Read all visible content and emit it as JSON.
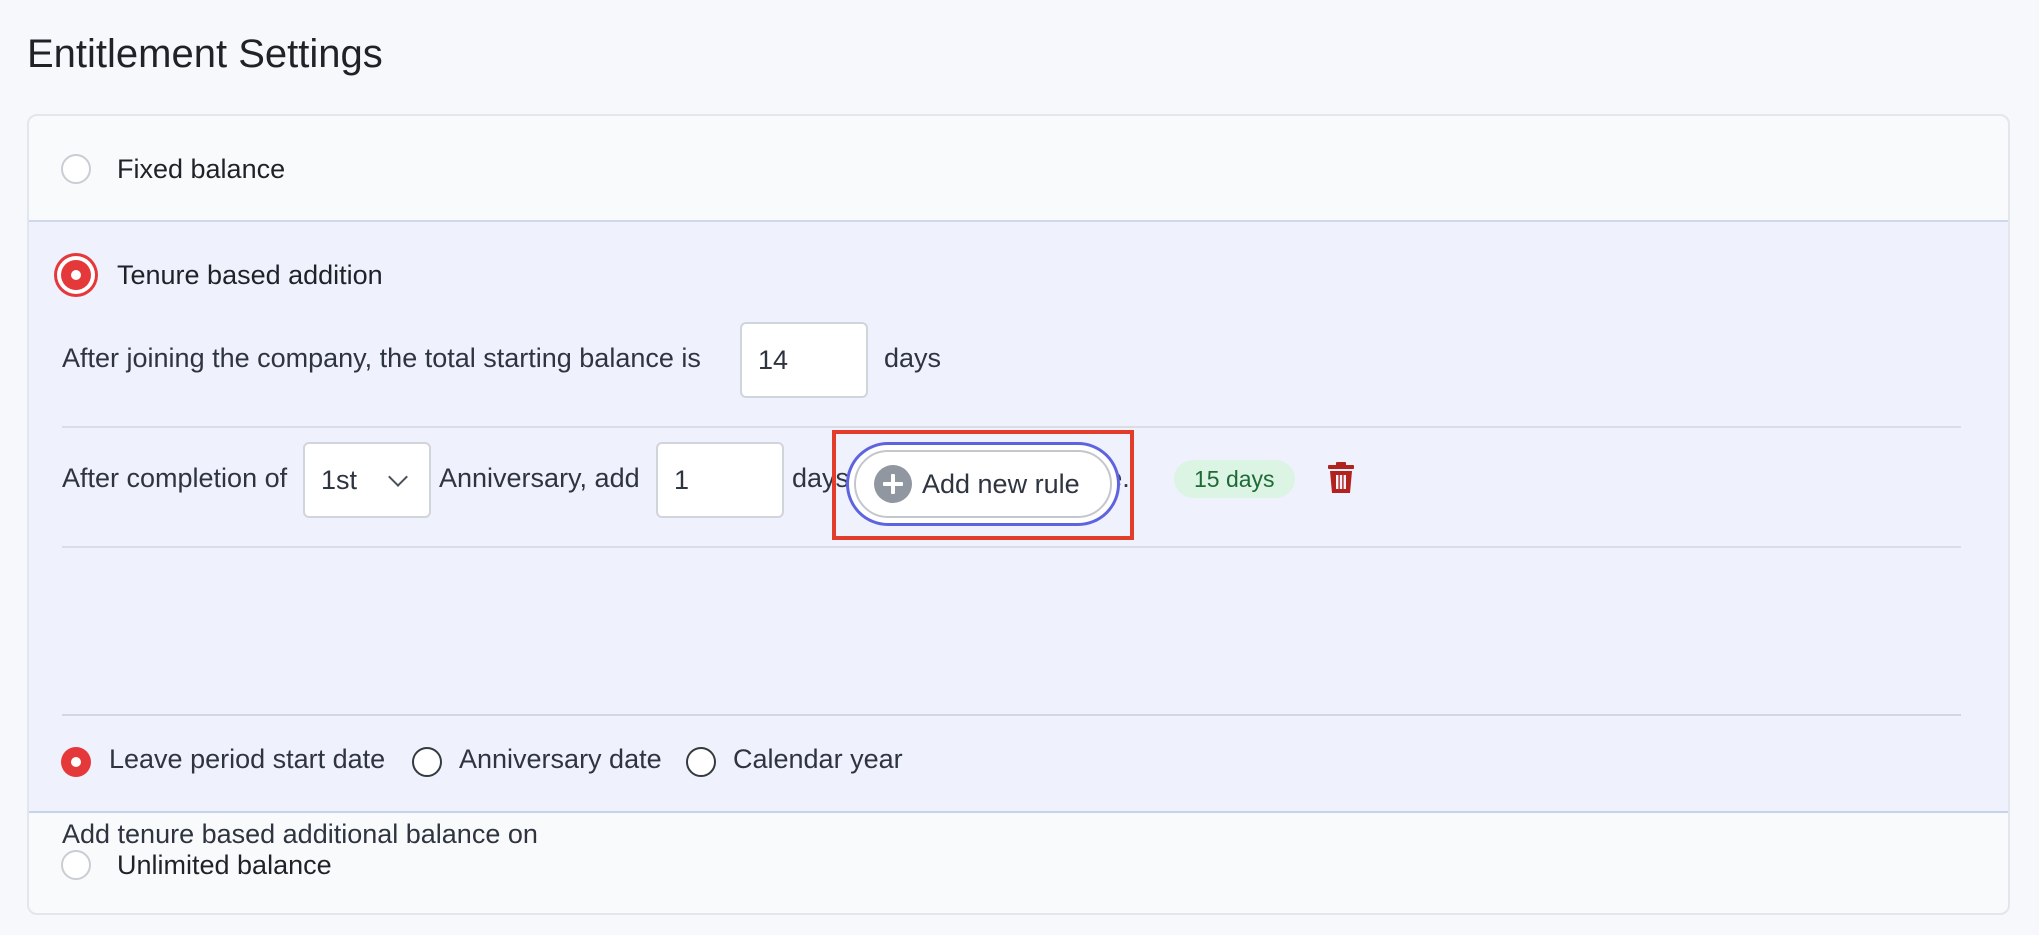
{
  "page": {
    "title": "Entitlement Settings"
  },
  "options": {
    "fixed": {
      "label": "Fixed balance",
      "selected": false
    },
    "tenure": {
      "label": "Tenure based addition",
      "selected": true
    },
    "unlimited": {
      "label": "Unlimited balance",
      "selected": false
    }
  },
  "tenure": {
    "starting_prefix": "After joining the company, the total starting balance is",
    "starting_value": "14",
    "starting_suffix": "days",
    "rules": [
      {
        "prefix": "After completion of",
        "anniversary": "1st",
        "middle": "Anniversary, add",
        "add_value": "1",
        "suffix": "days to the starting balance.",
        "total_badge": "15 days"
      }
    ],
    "add_rule_label": "Add new rule",
    "apply_on": {
      "heading": "Add tenure based additional balance on",
      "choices": [
        {
          "label": "Leave period start date",
          "selected": true
        },
        {
          "label": "Anniversary date",
          "selected": false
        },
        {
          "label": "Calendar year",
          "selected": false
        }
      ]
    }
  },
  "colors": {
    "accent_red": "#e5383b",
    "focus_blue": "#5e63e0",
    "highlight_box": "#e23c2a",
    "badge_bg": "#dcf4e4",
    "badge_text": "#1e6a37",
    "trash": "#b3231d",
    "selected_panel_bg": "#eff1fc"
  },
  "icons": {
    "delete": "trash-icon",
    "add": "plus-circle-icon",
    "dropdown": "chevron-down-icon"
  }
}
